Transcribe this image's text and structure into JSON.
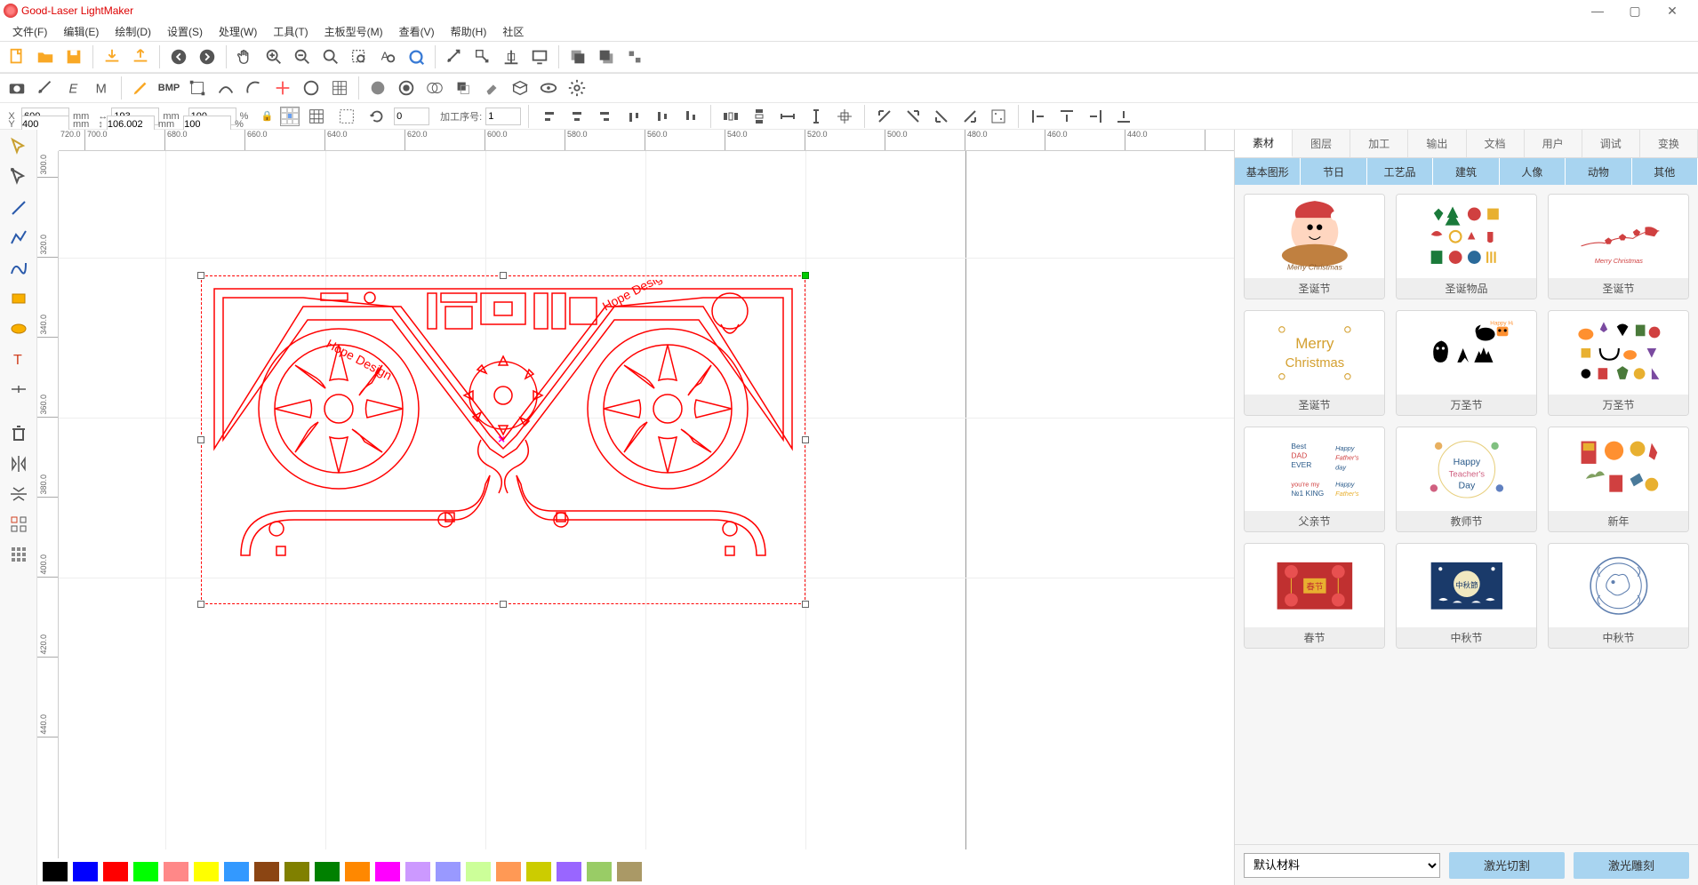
{
  "app_title": "Good-Laser LightMaker",
  "menubar": [
    "文件(F)",
    "编辑(E)",
    "绘制(D)",
    "设置(S)",
    "处理(W)",
    "工具(T)",
    "主板型号(M)",
    "查看(V)",
    "帮助(H)",
    "社区"
  ],
  "properties": {
    "x_label": "X",
    "x_value": "600",
    "x_unit": "mm",
    "y_label": "Y",
    "y_value": "400",
    "y_unit": "mm",
    "w_value": "193",
    "w_unit": "mm",
    "h_value": "106.002",
    "h_unit": "mm",
    "sx_value": "100",
    "sx_unit": "%",
    "sy_value": "100",
    "sy_unit": "%",
    "rotate_value": "0",
    "order_label": "加工序号:",
    "order_value": "1"
  },
  "rulers_h": [
    "720.0",
    "700.0",
    "680.0",
    "660.0",
    "640.0",
    "620.0",
    "600.0",
    "580.0",
    "560.0",
    "540.0",
    "520.0",
    "500.0",
    "480.0",
    "460.0",
    "440.0"
  ],
  "rulers_v": [
    "300.0",
    "320.0",
    "340.0",
    "360.0",
    "380.0",
    "400.0",
    "420.0",
    "440.0"
  ],
  "design_text_left": "Hope Design",
  "design_text_right": "Hope Design",
  "right_panel": {
    "tabs": [
      "素材",
      "图层",
      "加工",
      "输出",
      "文档",
      "用户",
      "调试",
      "变换"
    ],
    "active_tab": 0,
    "categories": [
      "基本图形",
      "节日",
      "工艺品",
      "建筑",
      "人像",
      "动物",
      "其他"
    ],
    "active_cat": 1,
    "items": [
      "圣诞节",
      "圣诞物品",
      "圣诞节",
      "圣诞节",
      "万圣节",
      "万圣节",
      "父亲节",
      "教师节",
      "新年",
      "春节",
      "中秋节",
      "中秋节"
    ],
    "material_label": "默认材料",
    "action_cut": "激光切割",
    "action_engrave": "激光雕刻"
  },
  "colors": [
    "#000000",
    "#0000ff",
    "#ff0000",
    "#00ff00",
    "#ff8888",
    "#ffff00",
    "#3399ff",
    "#8b4513",
    "#808000",
    "#008000",
    "#ff8800",
    "#ff00ff",
    "#cc99ff",
    "#9999ff",
    "#ccff99",
    "#ff9955",
    "#cccc00",
    "#9966ff",
    "#99cc66",
    "#aa9966"
  ]
}
